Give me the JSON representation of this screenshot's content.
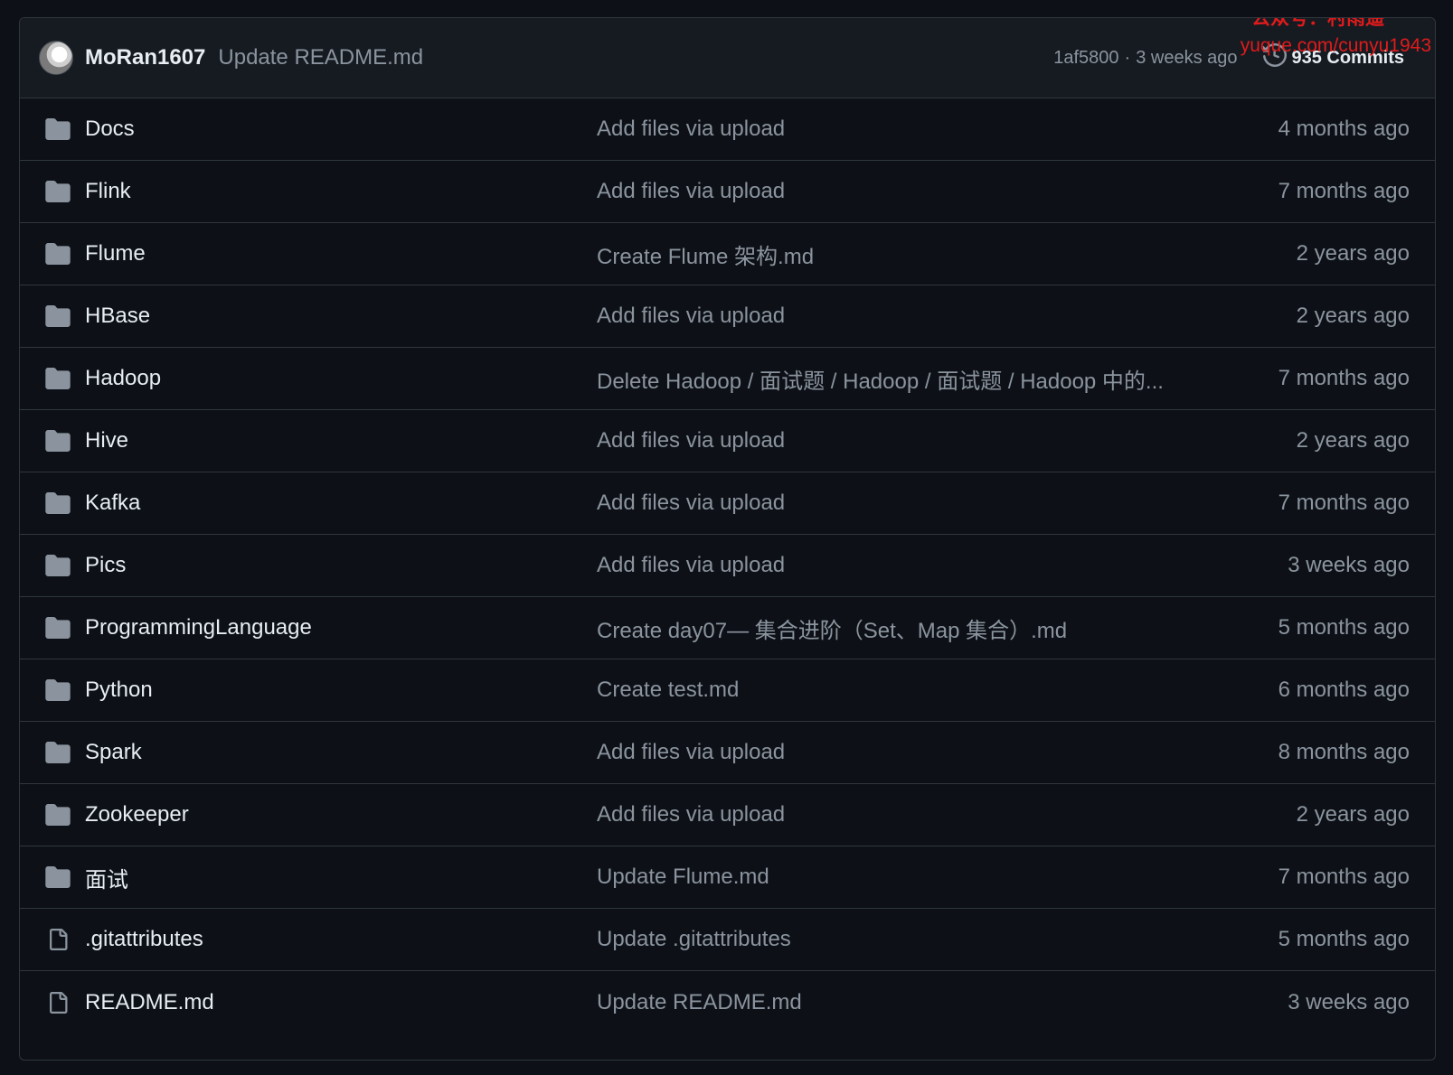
{
  "commit": {
    "author": "MoRan1607",
    "message": "Update README.md",
    "hash": "1af5800",
    "separator": "·",
    "when": "3 weeks ago",
    "commits_label": "935 Commits"
  },
  "watermark": {
    "line1": "公众号：村雨遥",
    "line2": "yuque.com/cunyu1943"
  },
  "files": [
    {
      "type": "folder",
      "name": "Docs",
      "message": "Add files via upload",
      "age": "4 months ago"
    },
    {
      "type": "folder",
      "name": "Flink",
      "message": "Add files via upload",
      "age": "7 months ago"
    },
    {
      "type": "folder",
      "name": "Flume",
      "message": "Create Flume 架构.md",
      "age": "2 years ago"
    },
    {
      "type": "folder",
      "name": "HBase",
      "message": "Add files via upload",
      "age": "2 years ago"
    },
    {
      "type": "folder",
      "name": "Hadoop",
      "message": "Delete Hadoop / 面试题 / Hadoop / 面试题 / Hadoop 中的...",
      "age": "7 months ago"
    },
    {
      "type": "folder",
      "name": "Hive",
      "message": "Add files via upload",
      "age": "2 years ago"
    },
    {
      "type": "folder",
      "name": "Kafka",
      "message": "Add files via upload",
      "age": "7 months ago"
    },
    {
      "type": "folder",
      "name": "Pics",
      "message": "Add files via upload",
      "age": "3 weeks ago"
    },
    {
      "type": "folder",
      "name": "ProgrammingLanguage",
      "message": "Create day07— 集合进阶（Set、Map 集合）.md",
      "age": "5 months ago"
    },
    {
      "type": "folder",
      "name": "Python",
      "message": "Create test.md",
      "age": "6 months ago"
    },
    {
      "type": "folder",
      "name": "Spark",
      "message": "Add files via upload",
      "age": "8 months ago"
    },
    {
      "type": "folder",
      "name": "Zookeeper",
      "message": "Add files via upload",
      "age": "2 years ago"
    },
    {
      "type": "folder",
      "name": "面试",
      "message": "Update Flume.md",
      "age": "7 months ago"
    },
    {
      "type": "file",
      "name": ".gitattributes",
      "message": "Update .gitattributes",
      "age": "5 months ago"
    },
    {
      "type": "file",
      "name": "README.md",
      "message": "Update README.md",
      "age": "3 weeks ago"
    }
  ],
  "colors": {
    "background": "#0d1117",
    "header_bg": "#161b22",
    "border": "#30363d",
    "text_primary": "#e6edf3",
    "text_muted": "#8b949e",
    "icon": "#8b949e",
    "watermark": "#e01b1b"
  },
  "icons": {
    "folder": "folder-icon",
    "file": "file-icon",
    "history": "history-icon"
  }
}
